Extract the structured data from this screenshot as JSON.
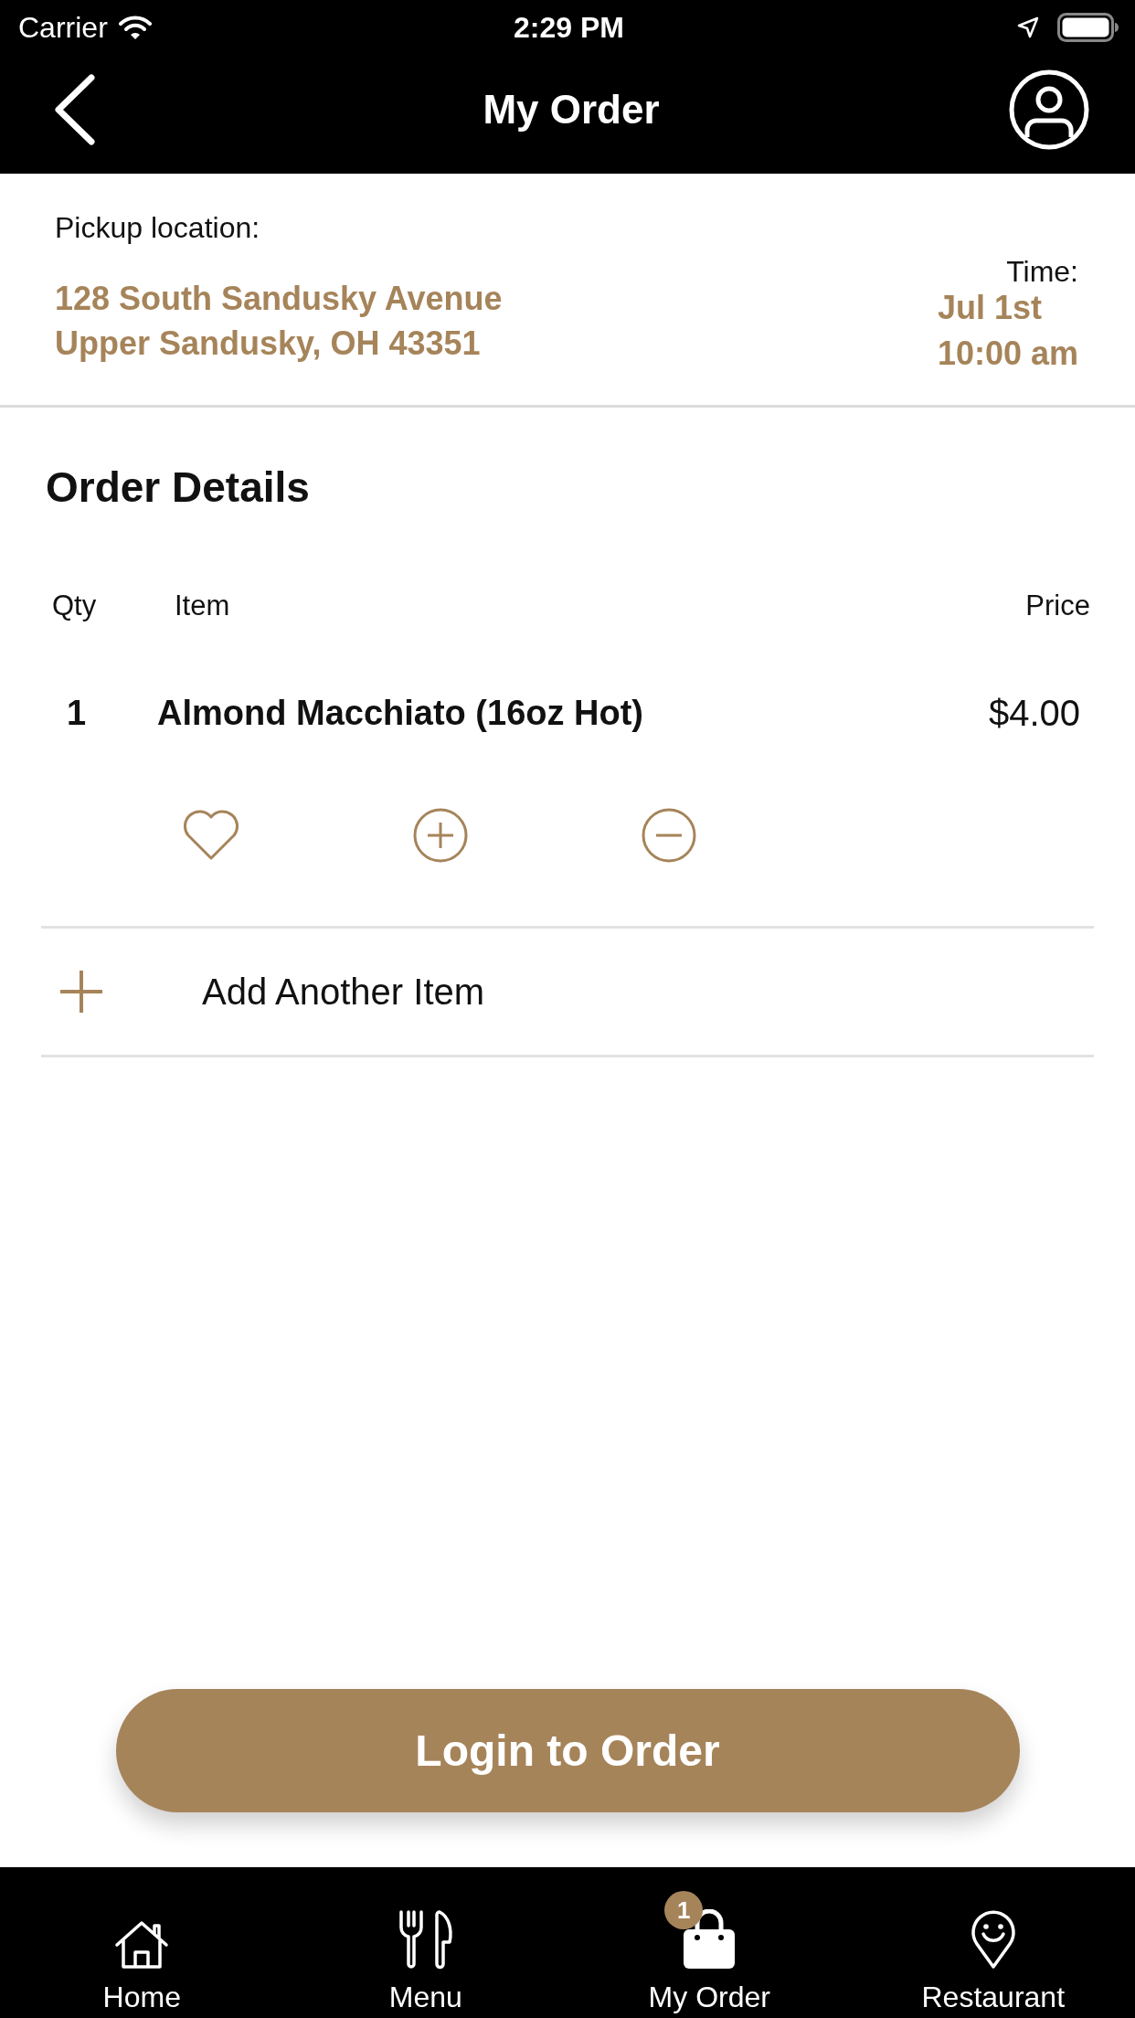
{
  "status_bar": {
    "carrier": "Carrier",
    "time": "2:29 PM"
  },
  "nav_bar": {
    "title": "My Order"
  },
  "pickup": {
    "label": "Pickup location:",
    "address_lines": [
      "128 South Sandusky Avenue",
      "Upper Sandusky, OH 43351"
    ],
    "time_label": "Time:",
    "date": "Jul 1st",
    "time": "10:00 am"
  },
  "order_details": {
    "title": "Order Details",
    "columns": [
      "Qty",
      "Item",
      "Price"
    ],
    "items": [
      {
        "qty": "1",
        "name": "Almond Macchiato (16oz Hot)",
        "price": "$4.00",
        "favorite": false
      }
    ],
    "add_item": "Add Another Item"
  },
  "login_button": "Login to Order",
  "tab_bar": [
    {
      "kind": "home",
      "label": "Home"
    },
    {
      "kind": "menu",
      "label": "Menu"
    },
    {
      "kind": "order",
      "label": "My Order",
      "badge": "1"
    },
    {
      "kind": "restaurant",
      "label": "Restaurant"
    }
  ]
}
